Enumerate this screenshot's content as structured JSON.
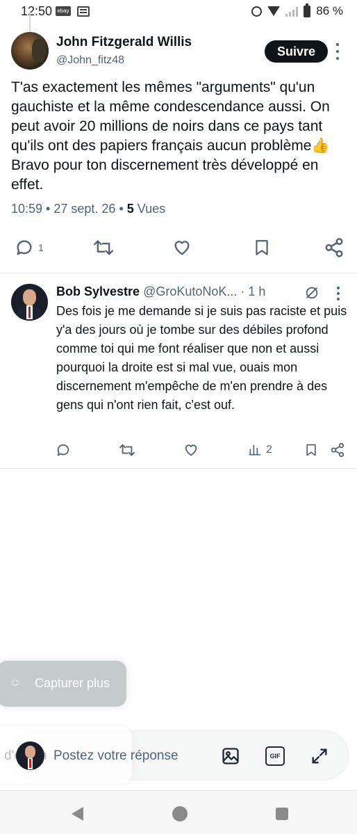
{
  "status_bar": {
    "time": "12:50",
    "ebay_badge": "ebay",
    "battery": "86 %"
  },
  "tweet": {
    "author_name": "John Fitzgerald Willis",
    "author_handle": "@John_fitz48",
    "follow_label": "Suivre",
    "text": "T'as exactement les mêmes \"arguments\" qu'un gauchiste et la même condescendance aussi. On peut avoir 20 millions de noirs dans ce pays tant qu'ils ont des papiers français aucun problème👍 Bravo pour ton discernement très développé en effet.",
    "time": "10:59",
    "date": "27 sept. 26",
    "views_count": "5",
    "views_label": "Vues",
    "reply_count": "1"
  },
  "reply": {
    "author_name": "Bob Sylvestre",
    "author_handle": "@GroKutoNoK...",
    "time": "· 1 h",
    "text": "Des fois je me demande si je suis pas raciste et puis y'a des jours où je tombe sur des débiles profond comme toi qui me font réaliser que non et aussi pourquoi la droite est si mal vue, ouais mon discernement m'empêche de m'en prendre à des gens qui n'ont rien fait, c'est ouf.",
    "views_count": "2"
  },
  "capture": {
    "label": "Capturer plus"
  },
  "composer": {
    "placeholder": "Postez votre réponse",
    "ghost_text": "d'écran",
    "gif_label": "GIF"
  },
  "colors": {
    "text_primary": "#0f1419",
    "text_secondary": "#536471",
    "follow_bg": "#0f1419"
  }
}
